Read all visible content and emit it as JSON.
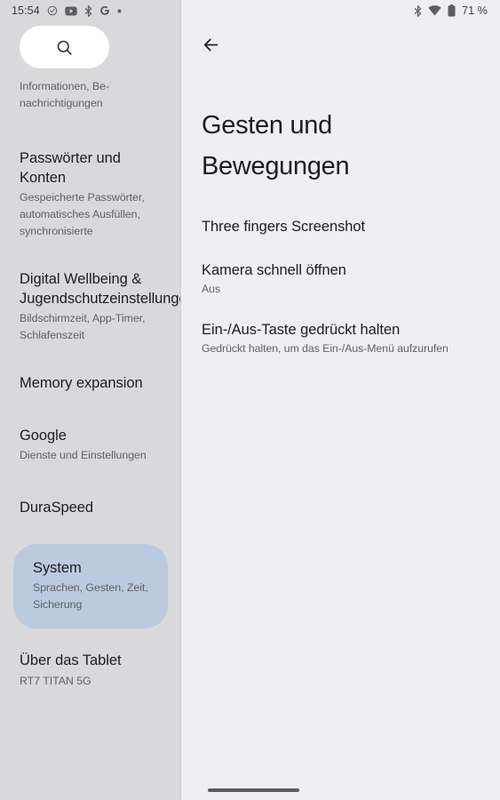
{
  "status_bar": {
    "time": "15:54",
    "left_icons": [
      {
        "name": "check-circle-icon"
      },
      {
        "name": "youtube-icon"
      },
      {
        "name": "bluetooth-icon"
      },
      {
        "name": "google-icon"
      },
      {
        "name": "dot-icon"
      }
    ],
    "right_icons": [
      {
        "name": "bluetooth-icon"
      },
      {
        "name": "wifi-icon"
      },
      {
        "name": "battery-icon"
      }
    ],
    "battery_level": "71 %"
  },
  "colors": {
    "sidebar_bg": "#d9d9db",
    "main_bg": "#eeeef3",
    "selected_item_bg": "#bbcade",
    "primary_text": "#1c1d20",
    "secondary_text": "#5e6165",
    "search_pill_bg": "#ffffff"
  },
  "sidebar": {
    "search": {
      "icon": "search-icon",
      "placeholder": ""
    },
    "items": [
      {
        "title": "",
        "subtitle": "Informationen, Be-\nnachrichtigungen",
        "subtitle_line1": "Informationen, Be-",
        "subtitle_line2": "nachrichtigungen",
        "selected": false,
        "partial": true
      },
      {
        "title": "Passwörter und Konten",
        "subtitle": "Gespeicherte Passwörter, automatisches Ausfüllen, synchronisierte",
        "selected": false
      },
      {
        "title": "Digital Wellbeing & Jugendschutzeinstellungen",
        "subtitle": "Bildschirmzeit, App-Timer, Schlafenszeit",
        "selected": false
      },
      {
        "title": "Memory expansion",
        "subtitle": "",
        "selected": false
      },
      {
        "title": "Google",
        "subtitle": "Dienste und Einstellungen",
        "selected": false
      },
      {
        "title": "DuraSpeed",
        "subtitle": "",
        "selected": false
      },
      {
        "title": "System",
        "subtitle": "Sprachen, Gesten, Zeit, Sicherung",
        "selected": true
      },
      {
        "title": "Über das Tablet",
        "subtitle": "RT7 TITAN 5G",
        "selected": false
      }
    ]
  },
  "main": {
    "back_icon": "back-arrow-icon",
    "title": "Gesten und Bewegungen",
    "preferences": [
      {
        "title": "Three fingers Screenshot",
        "subtitle": ""
      },
      {
        "title": "Kamera schnell öffnen",
        "subtitle": "Aus"
      },
      {
        "title": "Ein-/Aus-Taste gedrückt halten",
        "subtitle": "Gedrückt halten, um das Ein-/Aus-Menü aufzurufen"
      }
    ],
    "gesture_bar": "home-gesture-bar"
  }
}
